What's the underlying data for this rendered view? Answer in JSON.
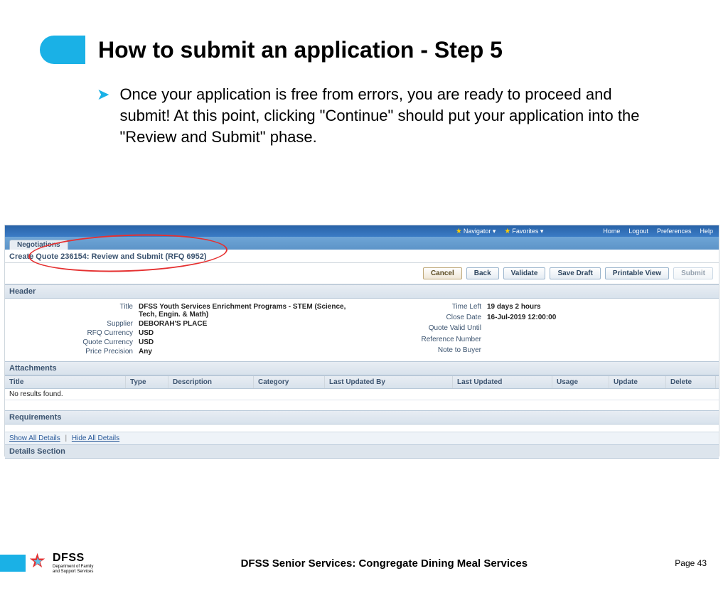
{
  "slide": {
    "title": "How to submit an application - Step 5",
    "bullet_text": "Once your application is free from errors, you are ready to proceed and submit!  At this point, clicking \"Continue\" should put your application into the \"Review and Submit\" phase."
  },
  "topbar": {
    "navigator": "Navigator ▾",
    "favorites": "Favorites ▾",
    "home": "Home",
    "logout": "Logout",
    "preferences": "Preferences",
    "help": "Help"
  },
  "tab": "Negotiations",
  "page_header": "Create Quote 236154: Review and Submit (RFQ 6952)",
  "buttons": {
    "cancel": "Cancel",
    "back": "Back",
    "validate": "Validate",
    "save_draft": "Save Draft",
    "printable": "Printable View",
    "submit": "Submit"
  },
  "sections": {
    "header": "Header",
    "attachments": "Attachments",
    "requirements": "Requirements",
    "details_section": "Details  Section"
  },
  "header_fields": {
    "left": {
      "title_label": "Title",
      "title_value": "DFSS Youth Services Enrichment Programs - STEM (Science, Tech, Engin. & Math)",
      "supplier_label": "Supplier",
      "supplier_value": "DEBORAH'S PLACE",
      "rfq_curr_label": "RFQ Currency",
      "rfq_curr_value": "USD",
      "quote_curr_label": "Quote Currency",
      "quote_curr_value": "USD",
      "price_prec_label": "Price Precision",
      "price_prec_value": "Any"
    },
    "right": {
      "time_left_label": "Time Left",
      "time_left_value": "19 days 2 hours",
      "close_date_label": "Close Date",
      "close_date_value": "16-Jul-2019 12:00:00",
      "valid_until_label": "Quote Valid Until",
      "ref_num_label": "Reference Number",
      "note_label": "Note to Buyer"
    }
  },
  "att_table": {
    "cols": [
      "Title",
      "Type",
      "Description",
      "Category",
      "Last Updated By",
      "Last Updated",
      "Usage",
      "Update",
      "Delete"
    ],
    "no_results": "No results found."
  },
  "links": {
    "show_all": "Show All Details",
    "hide_all": "Hide All Details"
  },
  "footer": {
    "logo_main": "DFSS",
    "logo_sub1": "Department of Family",
    "logo_sub2": "and Support Services",
    "title": "DFSS Senior Services: Congregate Dining Meal Services",
    "page": "Page 43"
  }
}
